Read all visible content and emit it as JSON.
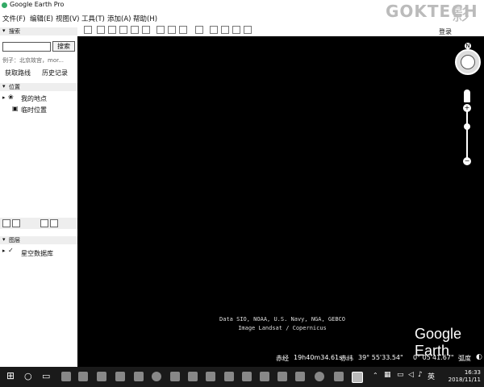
{
  "window": {
    "title": "Google Earth Pro"
  },
  "brand": {
    "text": "GOKTECH",
    "cn": "影"
  },
  "menu": [
    "文件(F)",
    "编辑(E)",
    "视图(V)",
    "工具(T)",
    "添加(A)",
    "帮助(H)"
  ],
  "header": {
    "login": "登录"
  },
  "search": {
    "section": "搜索",
    "button": "搜索",
    "hint": "例子：北京故宫，mor...",
    "directions": "获取路线",
    "history": "历史记录"
  },
  "places": {
    "section": "位置",
    "items": [
      "我的地点",
      "临时位置"
    ]
  },
  "layers": {
    "section": "图层",
    "items": [
      "星空数据库"
    ]
  },
  "map": {
    "attribution": [
      "Data SIO, NOAA, U.S. Navy, NGA, GEBCO",
      "Image Landsat / Copernicus"
    ],
    "logo": "Google Earth",
    "north": "N",
    "zoom_in": "+",
    "zoom_out": "−"
  },
  "status": {
    "ra_label": "赤经",
    "ra_value": "19h40m34.61s",
    "dec_label": "赤纬",
    "dec_value": "39° 55'33.54\"",
    "fov_value": "0° 05'41.67\"",
    "fov_label": "弧度"
  },
  "taskbar": {
    "ime": "英",
    "time": "16:33",
    "date": "2018/11/11"
  }
}
